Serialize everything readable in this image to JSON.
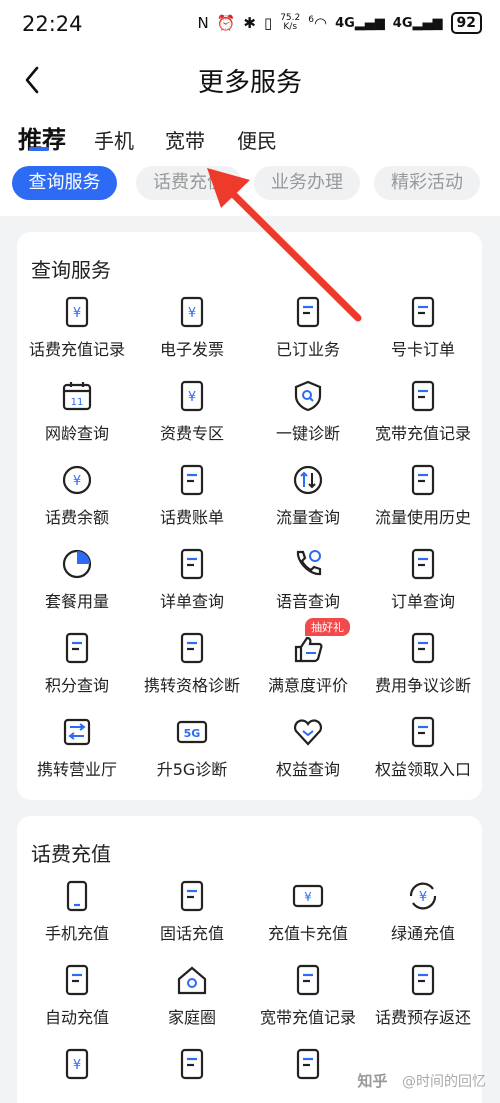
{
  "status_bar": {
    "time": "22:24",
    "speed": "75.2",
    "speed_unit": "K/s",
    "wifi_gen": "6",
    "sig1": "4G",
    "sig2": "4G",
    "battery": "92"
  },
  "header": {
    "title": "更多服务"
  },
  "tabs": [
    {
      "label": "推荐"
    },
    {
      "label": "手机"
    },
    {
      "label": "宽带"
    },
    {
      "label": "便民"
    }
  ],
  "chips": [
    {
      "label": "查询服务"
    },
    {
      "label": "话费充值"
    },
    {
      "label": "业务办理"
    },
    {
      "label": "精彩活动"
    }
  ],
  "query_section": {
    "title": "查询服务",
    "items": [
      {
        "label": "话费充值记录",
        "icon": "bill-yen-icon"
      },
      {
        "label": "电子发票",
        "icon": "receipt-icon"
      },
      {
        "label": "已订业务",
        "icon": "doc-check-icon"
      },
      {
        "label": "号卡订单",
        "icon": "sim-order-icon"
      },
      {
        "label": "网龄查询",
        "icon": "calendar-icon"
      },
      {
        "label": "资费专区",
        "icon": "tariff-icon"
      },
      {
        "label": "一键诊断",
        "icon": "shield-search-icon"
      },
      {
        "label": "宽带充值记录",
        "icon": "broadband-record-icon"
      },
      {
        "label": "话费余额",
        "icon": "yen-circle-icon"
      },
      {
        "label": "话费账单",
        "icon": "clipboard-icon"
      },
      {
        "label": "流量查询",
        "icon": "data-flow-icon"
      },
      {
        "label": "流量使用历史",
        "icon": "chart-phone-icon"
      },
      {
        "label": "套餐用量",
        "icon": "pie-chart-icon"
      },
      {
        "label": "详单查询",
        "icon": "magnifier-doc-icon"
      },
      {
        "label": "语音查询",
        "icon": "phone-clock-icon"
      },
      {
        "label": "订单查询",
        "icon": "order-search-icon"
      },
      {
        "label": "积分查询",
        "icon": "coin-search-icon"
      },
      {
        "label": "携转资格诊断",
        "icon": "phone-transfer-icon"
      },
      {
        "label": "满意度评价",
        "icon": "thumbs-up-icon",
        "badge": "抽好礼"
      },
      {
        "label": "费用争议诊断",
        "icon": "fee-dispute-icon"
      },
      {
        "label": "携转营业厅",
        "icon": "store-icon"
      },
      {
        "label": "升5G诊断",
        "icon": "5g-icon",
        "icon_text": "5G"
      },
      {
        "label": "权益查询",
        "icon": "heart-icon"
      },
      {
        "label": "权益领取入口",
        "icon": "benefit-doc-icon"
      }
    ]
  },
  "recharge_section": {
    "title": "话费充值",
    "items": [
      {
        "label": "手机充值",
        "icon": "phone-icon"
      },
      {
        "label": "固话充值",
        "icon": "landline-icon"
      },
      {
        "label": "充值卡充值",
        "icon": "card-yen-icon"
      },
      {
        "label": "绿通充值",
        "icon": "yen-cycle-icon"
      },
      {
        "label": "自动充值",
        "icon": "phone-auto-icon"
      },
      {
        "label": "家庭圈",
        "icon": "home-icon"
      },
      {
        "label": "宽带充值记录",
        "icon": "broadband-record-icon"
      },
      {
        "label": "话费预存返还",
        "icon": "card-return-icon"
      },
      {
        "label": "",
        "icon": "bill-router-icon"
      },
      {
        "label": "",
        "icon": "phone-swap-icon"
      },
      {
        "label": "",
        "icon": "phone-up-icon"
      }
    ]
  },
  "watermark": {
    "logo": "知乎",
    "author": "@时间的回忆"
  },
  "colors": {
    "accent": "#2e6bf5",
    "arrow": "#ee3a2a",
    "badge": "#f24a4a"
  }
}
